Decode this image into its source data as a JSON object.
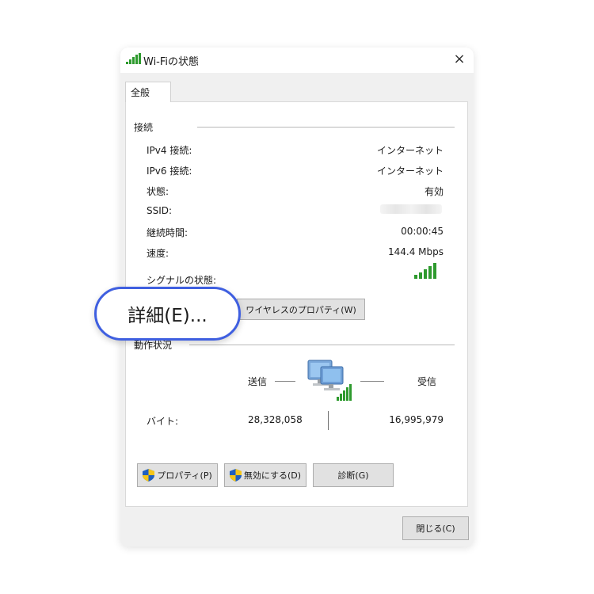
{
  "window": {
    "title": "Wi-Fiの状態",
    "close_label": "×"
  },
  "tabs": [
    {
      "label": "全般"
    }
  ],
  "connection": {
    "group_label": "接続",
    "rows": [
      {
        "label": "IPv4 接続:",
        "value": "インターネット"
      },
      {
        "label": "IPv6 接続:",
        "value": "インターネット"
      },
      {
        "label": "状態:",
        "value": "有効"
      },
      {
        "label": "SSID:",
        "value": ""
      },
      {
        "label": "継続時間:",
        "value": "00:00:45"
      },
      {
        "label": "速度:",
        "value": "144.4 Mbps"
      }
    ],
    "signal_label": "シグナルの状態:",
    "signal_bars": 5,
    "details_button": "詳細(E)...",
    "wireless_props_button": "ワイヤレスのプロパティ(W)"
  },
  "activity": {
    "group_label": "動作状況",
    "sent_label": "送信",
    "received_label": "受信",
    "bytes_label": "バイト:",
    "bytes_sent": "28,328,058",
    "bytes_received": "16,995,979"
  },
  "actions": {
    "properties_button": "プロパティ(P)",
    "disable_button": "無効にする(D)",
    "diagnose_button": "診断(G)"
  },
  "footer": {
    "close_button": "閉じる(C)"
  },
  "colors": {
    "callout_border": "#3f5fe0",
    "signal_green": "#2e9a2e",
    "shield_blue": "#1f5fbf",
    "shield_yellow": "#f5c518"
  }
}
